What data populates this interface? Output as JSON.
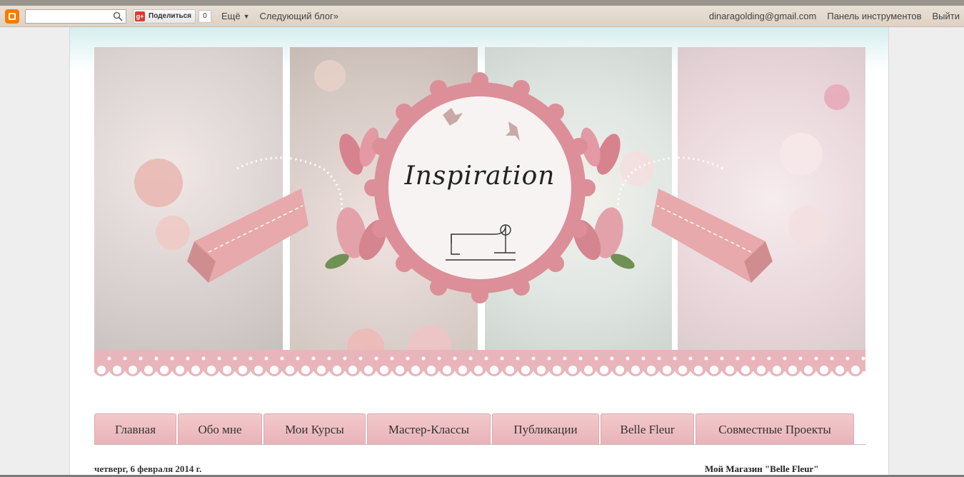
{
  "navbar": {
    "share_label": "Поделиться",
    "gplus_label": "g+",
    "share_count": "0",
    "more_label": "Ещё",
    "next_blog_label": "Следующий блог»",
    "user_email": "dinaragolding@gmail.com",
    "dashboard_label": "Панель инструментов",
    "signout_label": "Выйти"
  },
  "header": {
    "title": "Inspiration"
  },
  "tabs": [
    {
      "label": "Главная"
    },
    {
      "label": "Обо мне"
    },
    {
      "label": "Мои Курсы"
    },
    {
      "label": "Мастер-Классы"
    },
    {
      "label": "Публикации"
    },
    {
      "label": "Belle Fleur"
    },
    {
      "label": "Совместные Проекты"
    }
  ],
  "post": {
    "date": "четверг, 6 февраля 2014 г."
  },
  "sidebar": {
    "shop_title": "Мой Магазин \"Belle Fleur\""
  },
  "colors": {
    "accent_pink": "#e8b3b8",
    "navbar_bg": "#e2d8cc",
    "blogger_orange": "#f57d00"
  }
}
